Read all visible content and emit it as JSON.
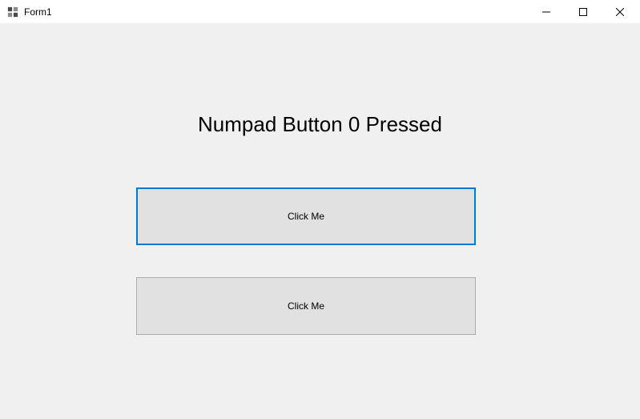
{
  "window": {
    "title": "Form1"
  },
  "content": {
    "heading": "Numpad Button 0 Pressed",
    "button1_label": "Click Me",
    "button2_label": "Click Me"
  }
}
